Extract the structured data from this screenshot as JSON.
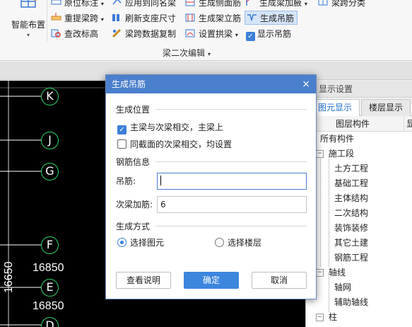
{
  "ribbon": {
    "smart_layout_label": "智能布置",
    "items": {
      "original_label": "原位标注",
      "apply_same_name": "应用到同名梁",
      "gen_side_rebar": "生成侧面筋",
      "gen_haunch": "生成梁加腋",
      "span_classify": "梁跨分类",
      "re_extract_span": "重提梁跨",
      "refresh_support": "刷新支座尺寸",
      "gen_stirrup_standing": "生成架立筋",
      "gen_hanger": "生成吊筋",
      "check_elevation": "查改标高",
      "copy_span_data": "梁跨数据复制",
      "set_arch_beam": "设置拱梁",
      "show_hanger": "显示吊筋"
    },
    "group_label": "梁二次编辑"
  },
  "canvas": {
    "axes": [
      "K",
      "J",
      "G",
      "F",
      "E",
      "D"
    ],
    "dims": [
      "16850",
      "16650",
      "16850"
    ]
  },
  "panel": {
    "title": "显示设置",
    "tabs": [
      "图元显示",
      "楼层显示"
    ],
    "col_component": "图层构件",
    "col_show": "显",
    "tree": {
      "all": "所有构件",
      "construction": "施工段",
      "earthwork": "土方工程",
      "foundation": "基础工程",
      "main_structure": "主体结构",
      "secondary_structure": "二次结构",
      "decoration": "装饰装修",
      "other_civil": "其它土建",
      "rebar_works": "钢筋工程",
      "axis": "轴线",
      "axis_grid": "轴网",
      "aux_axis": "辅助轴线",
      "column": "柱"
    }
  },
  "dialog": {
    "title": "生成吊筋",
    "close_icon_char": "×",
    "section_position": "生成位置",
    "opt_main_secondary": "主梁与次梁相交，主梁上",
    "opt_same_section": "同截面的次梁相交，均设置",
    "section_rebar": "钢筋信息",
    "label_hanger": "吊筋:",
    "hanger_value": "",
    "label_extra": "次梁加筋:",
    "extra_value": "6",
    "section_mode": "生成方式",
    "radio_select_elements": "选择图元",
    "radio_select_floors": "选择楼层",
    "btn_help": "查看说明",
    "btn_ok": "确定",
    "btn_cancel": "取消"
  }
}
